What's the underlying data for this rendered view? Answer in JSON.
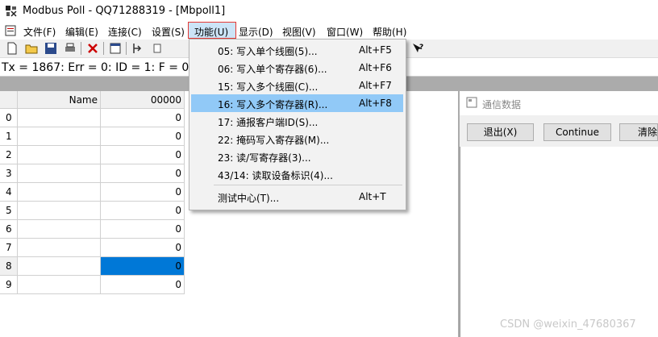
{
  "window": {
    "title": "Modbus Poll - QQ71288319 - [Mbpoll1]"
  },
  "menubar": {
    "items": [
      "文件(F)",
      "编辑(E)",
      "连接(C)",
      "设置(S)",
      "功能(U)",
      "显示(D)",
      "视图(V)",
      "窗口(W)",
      "帮助(H)"
    ]
  },
  "status_line": "Tx = 1867: Err = 0: ID = 1: F = 03: S",
  "grid": {
    "header_name": "Name",
    "header_col": "00000",
    "rows": [
      {
        "num": "0",
        "value": "0"
      },
      {
        "num": "1",
        "value": "0"
      },
      {
        "num": "2",
        "value": "0"
      },
      {
        "num": "3",
        "value": "0"
      },
      {
        "num": "4",
        "value": "0"
      },
      {
        "num": "5",
        "value": "0"
      },
      {
        "num": "6",
        "value": "0"
      },
      {
        "num": "7",
        "value": "0"
      },
      {
        "num": "8",
        "value": "0"
      },
      {
        "num": "9",
        "value": "0"
      }
    ],
    "selected_row": 8
  },
  "function_menu": {
    "items": [
      {
        "label": "05:  写入单个线圈(5)...",
        "shortcut": "Alt+F5"
      },
      {
        "label": "06:  写入单个寄存器(6)...",
        "shortcut": "Alt+F6"
      },
      {
        "label": "15:  写入多个线圈(C)...",
        "shortcut": "Alt+F7"
      },
      {
        "label": "16:  写入多个寄存器(R)...",
        "shortcut": "Alt+F8"
      },
      {
        "label": "17:  通报客户端ID(S)...",
        "shortcut": ""
      },
      {
        "label": "22:  掩码写入寄存器(M)...",
        "shortcut": ""
      },
      {
        "label": "23:  读/写寄存器(3)...",
        "shortcut": ""
      },
      {
        "label": "43/14:  读取设备标识(4)...",
        "shortcut": ""
      },
      {
        "label": "测试中心(T)...",
        "shortcut": "Alt+T"
      }
    ],
    "highlighted_index": 3
  },
  "comm_window": {
    "title": "通信数据",
    "buttons": [
      "退出(X)",
      "Continue",
      "清除"
    ]
  },
  "watermark": "CSDN @weixin_47680367",
  "colors": {
    "selection": "#0078d7",
    "menu_highlight": "#91c9f7",
    "focus_box": "#e53935"
  }
}
